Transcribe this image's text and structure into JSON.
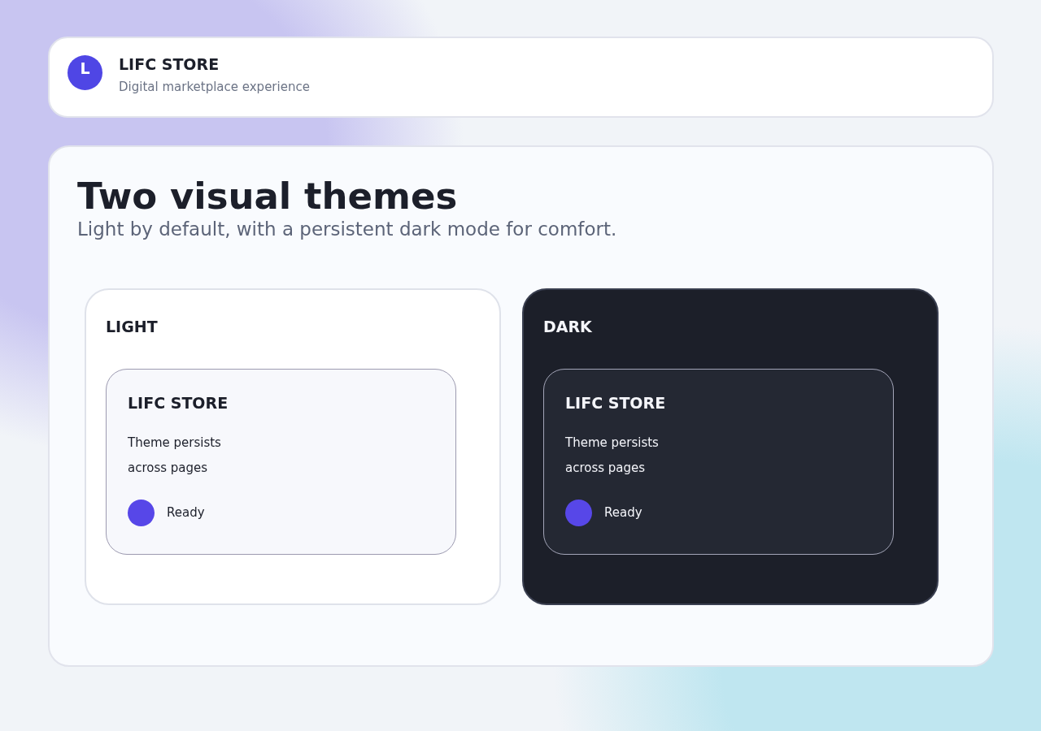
{
  "header": {
    "initial": "L",
    "name": "LIFC STORE",
    "tagline": "Digital marketplace experience"
  },
  "hero": {
    "title": "Two visual themes",
    "subtitle": "Light by default, with a persistent dark mode for comfort."
  },
  "themes": [
    {
      "label": "LIGHT",
      "kind": "light",
      "preview": {
        "name": "LIFC STORE",
        "lines": [
          "Theme persists",
          "across pages"
        ],
        "status": "Ready"
      }
    },
    {
      "label": "DARK",
      "kind": "dark",
      "preview": {
        "name": "LIFC STORE",
        "lines": [
          "Theme persists",
          "across pages"
        ],
        "status": "Ready"
      }
    }
  ]
}
